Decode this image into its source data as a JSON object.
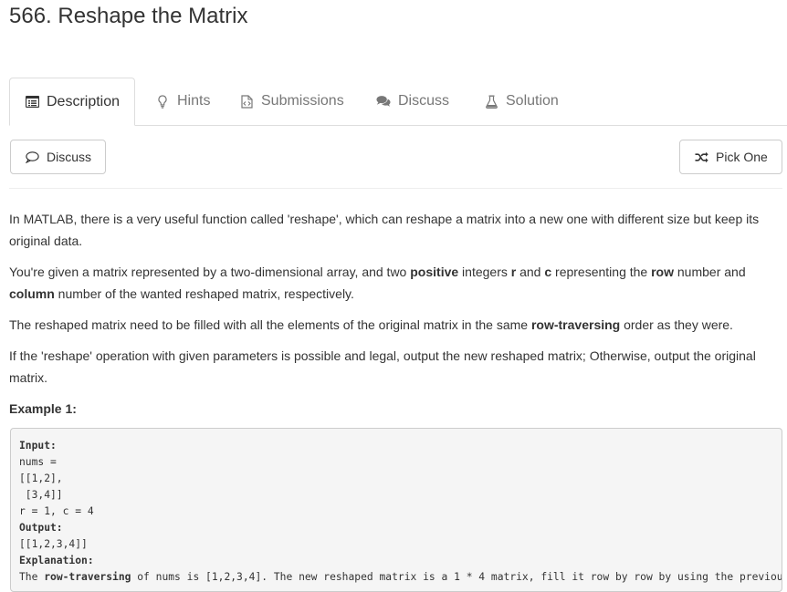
{
  "problem": {
    "title": "566. Reshape the Matrix"
  },
  "tabs": [
    {
      "label": "Description",
      "icon": "list-alt-icon",
      "active": true
    },
    {
      "label": "Hints",
      "icon": "lightbulb-icon"
    },
    {
      "label": "Submissions",
      "icon": "file-code-icon"
    },
    {
      "label": "Discuss",
      "icon": "comments-icon"
    },
    {
      "label": "Solution",
      "icon": "flask-icon"
    }
  ],
  "actions": {
    "discuss_label": "Discuss",
    "pick_one_label": "Pick One"
  },
  "description": {
    "p1": "In MATLAB, there is a very useful function called 'reshape', which can reshape a matrix into a new one with different size but keep its original data.",
    "p2_a": "You're given a matrix represented by a two-dimensional array, and two ",
    "p2_positive": "positive",
    "p2_b": " integers ",
    "p2_r": "r",
    "p2_c_and": " and ",
    "p2_c": "c",
    "p2_d": " representing the ",
    "p2_row": "row",
    "p2_e": " number and ",
    "p2_column": "column",
    "p2_f": " number of the wanted reshaped matrix, respectively.",
    "p3_a": "The reshaped matrix need to be filled with all the elements of the original matrix in the same ",
    "p3_bold": "row-traversing",
    "p3_b": " order as they were.",
    "p4": "If the 'reshape' operation with given parameters is possible and legal, output the new reshaped matrix; Otherwise, output the original matrix.",
    "example_heading": "Example 1:"
  },
  "example": {
    "input_label": "Input:",
    "input_lines": "nums =\n[[1,2],\n [3,4]]\nr = 1, c = 4",
    "output_label": "Output:",
    "output_lines": "[[1,2,3,4]]",
    "explanation_label": "Explanation:",
    "explanation_a": "The ",
    "explanation_bold": "row-traversing",
    "explanation_b": " of nums is [1,2,3,4]. The new reshaped matrix is a 1 * 4 matrix, fill it row by row by using the previous list."
  },
  "colors": {
    "text": "#333333",
    "muted": "#777777",
    "border": "#dddddd",
    "code_bg": "#f5f5f5"
  }
}
